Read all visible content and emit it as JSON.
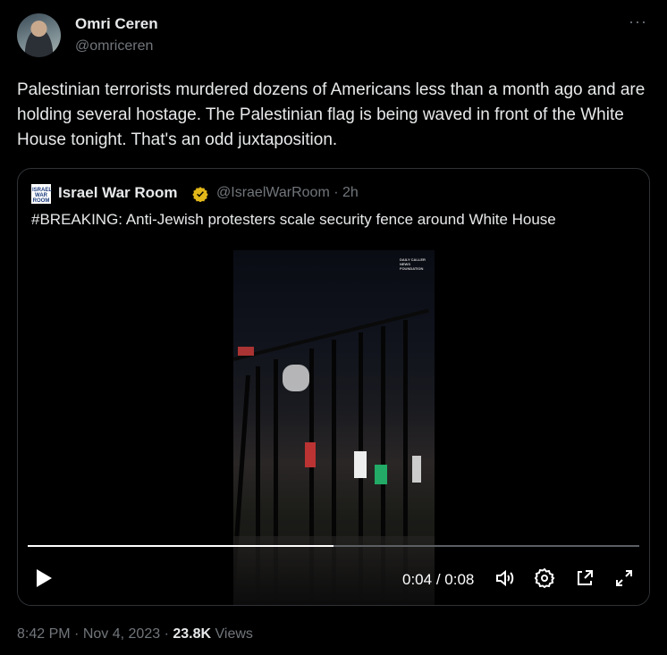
{
  "author": {
    "name": "Omri Ceren",
    "handle": "@omriceren"
  },
  "menu_icon": "more-horizontal-icon",
  "tweet_text": "Palestinian terrorists murdered dozens of Americans less than a month ago and are holding several hostage. The Palestinian flag is being waved in front of the White House tonight. That's an odd juxtaposition.",
  "quoted": {
    "logo_text": "ISRAEL WAR ROOM",
    "name": "Israel War Room",
    "handle": "@IsraelWarRoom",
    "separator": "·",
    "time": "2h",
    "text": "#BREAKING: Anti-Jewish protesters scale security fence around White House",
    "video_watermark": "DAILY CALLER NEWS FOUNDATION",
    "video": {
      "current": "0:04",
      "duration": "0:08",
      "progress": 0.5
    }
  },
  "footer": {
    "time": "8:42 PM",
    "date": "Nov 4, 2023",
    "views_count": "23.8K",
    "views_label": "Views",
    "dot": "·"
  },
  "colors": {
    "badge": "#e2b719",
    "text": "#e7e9ea",
    "muted": "#71767b",
    "border": "#2f3336"
  }
}
